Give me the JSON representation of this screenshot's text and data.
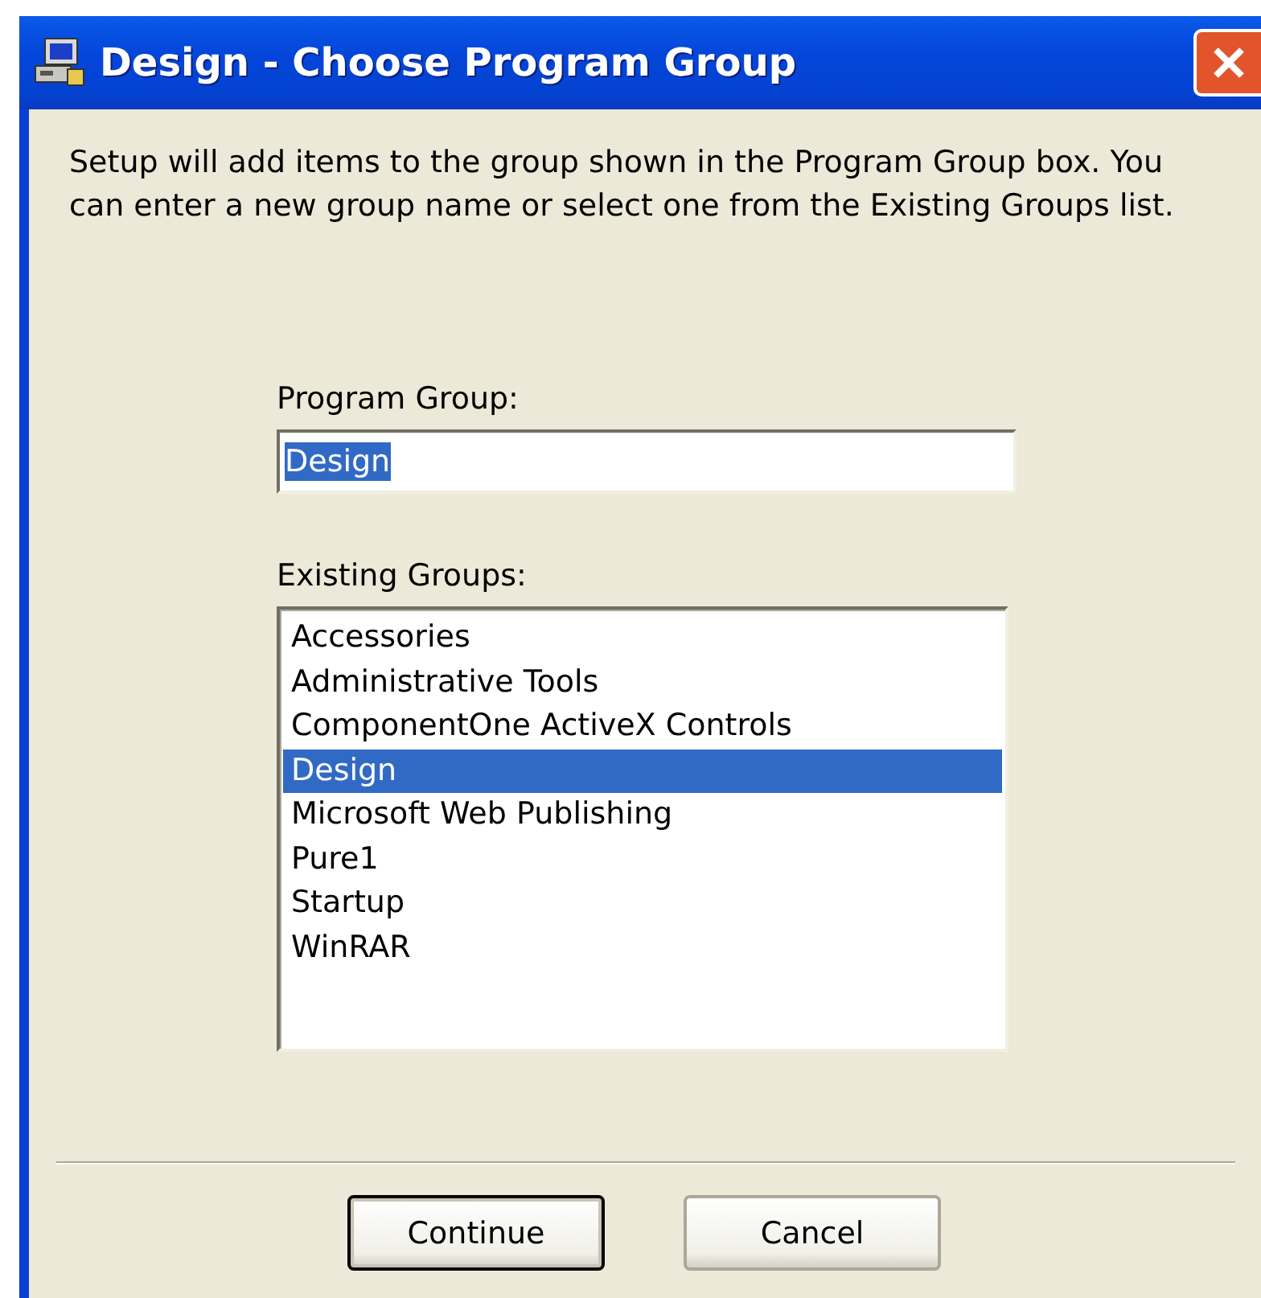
{
  "window": {
    "title": "Design - Choose Program Group"
  },
  "description": "Setup will add items to the group shown in the Program Group box. You can enter a new group name or select one from the Existing Groups list.",
  "program_group": {
    "label": "Program Group:",
    "value": "Design",
    "text_selected": true
  },
  "existing_groups": {
    "label": "Existing Groups:",
    "items": [
      {
        "label": "Accessories",
        "selected": false
      },
      {
        "label": "Administrative Tools",
        "selected": false
      },
      {
        "label": "ComponentOne ActiveX Controls",
        "selected": false
      },
      {
        "label": "Design",
        "selected": true
      },
      {
        "label": "Microsoft Web Publishing",
        "selected": false
      },
      {
        "label": "Pure1",
        "selected": false
      },
      {
        "label": "Startup",
        "selected": false
      },
      {
        "label": "WinRAR",
        "selected": false
      }
    ]
  },
  "buttons": [
    {
      "label": "Continue",
      "default": true
    },
    {
      "label": "Cancel",
      "default": false
    }
  ]
}
